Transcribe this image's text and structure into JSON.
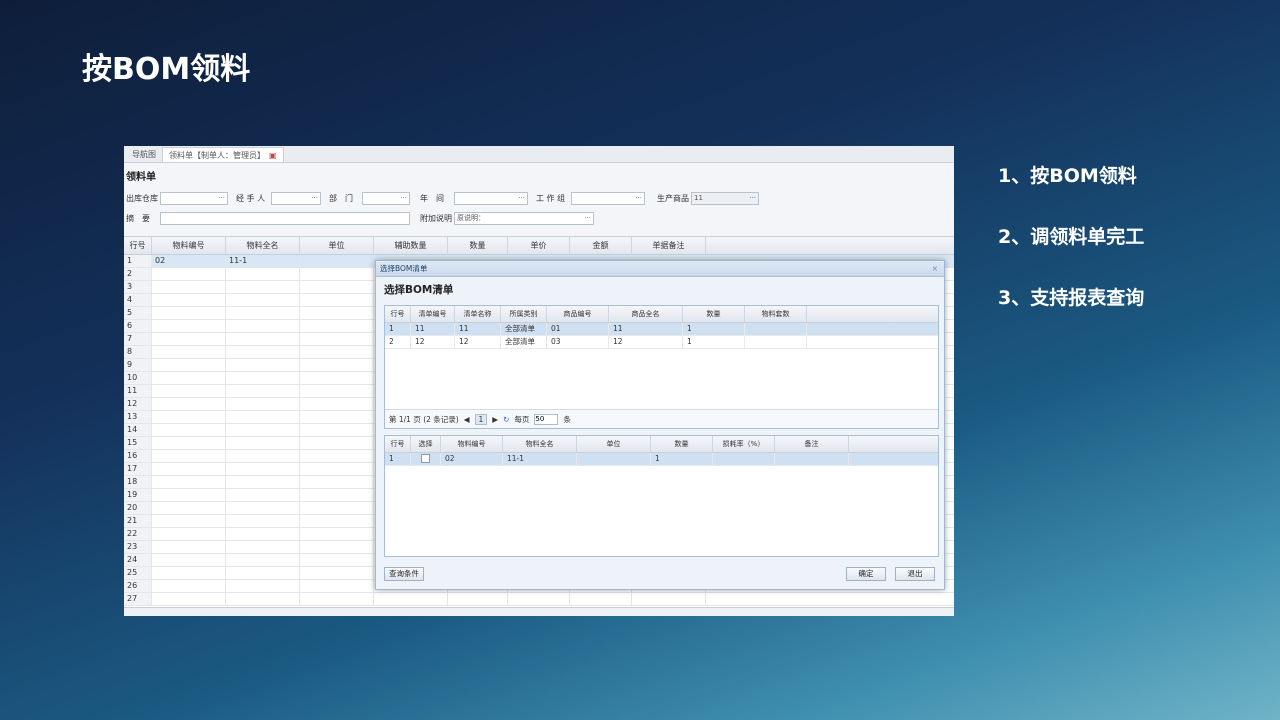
{
  "slide": {
    "title": "按BOM领料",
    "bullets": [
      "1、按BOM领料",
      "2、调领料单完工",
      "3、支持报表查询"
    ]
  },
  "app": {
    "tabs": [
      {
        "label": "导航图"
      },
      {
        "label": "领料单【制单人：管理员】"
      }
    ],
    "form_title": "领料单",
    "fields": {
      "warehouse": "出库仓库",
      "handler": "经 手 人",
      "dept": "部　门",
      "year": "年　间",
      "workgroup": "工 作 组",
      "product": "生产商品",
      "product_value": "11",
      "summary": "摘　要",
      "attach": "附加说明",
      "attach_value": "原说明："
    },
    "grid": {
      "headers": [
        "行号",
        "物料编号",
        "物料全名",
        "单位",
        "辅助数量",
        "数量",
        "单价",
        "金额",
        "单据备注"
      ],
      "first_row": [
        "1",
        "02",
        "11-1"
      ],
      "row_numbers": [
        "2",
        "3",
        "4",
        "5",
        "6",
        "7",
        "8",
        "9",
        "10",
        "11",
        "12",
        "13",
        "14",
        "15",
        "16",
        "17",
        "18",
        "19",
        "20",
        "21",
        "22",
        "23",
        "24",
        "25",
        "26",
        "27"
      ]
    }
  },
  "dialog": {
    "header": "选择BOM清单",
    "title": "选择BOM清单",
    "close": "×",
    "top_headers": [
      "行号",
      "清单编号",
      "清单名称",
      "所属类别",
      "商品编号",
      "商品全名",
      "数量",
      "物料套数"
    ],
    "top_rows": [
      [
        "1",
        "11",
        "11",
        "全部清单",
        "01",
        "11",
        "1",
        ""
      ],
      [
        "2",
        "12",
        "12",
        "全部清单",
        "03",
        "12",
        "1",
        ""
      ]
    ],
    "pager": {
      "info": "第 1/1 页 (2 条记录)",
      "page": "1",
      "per_page_label": "每页",
      "per_page": "50",
      "unit": "条"
    },
    "bottom_headers": [
      "行号",
      "选择",
      "物料编号",
      "物料全名",
      "单位",
      "数量",
      "损耗率（%）",
      "备注"
    ],
    "bottom_rows": [
      [
        "1",
        "",
        "02",
        "11-1",
        "",
        "1",
        "",
        ""
      ]
    ],
    "buttons": {
      "query": "查询条件",
      "ok": "确定",
      "exit": "退出"
    }
  }
}
